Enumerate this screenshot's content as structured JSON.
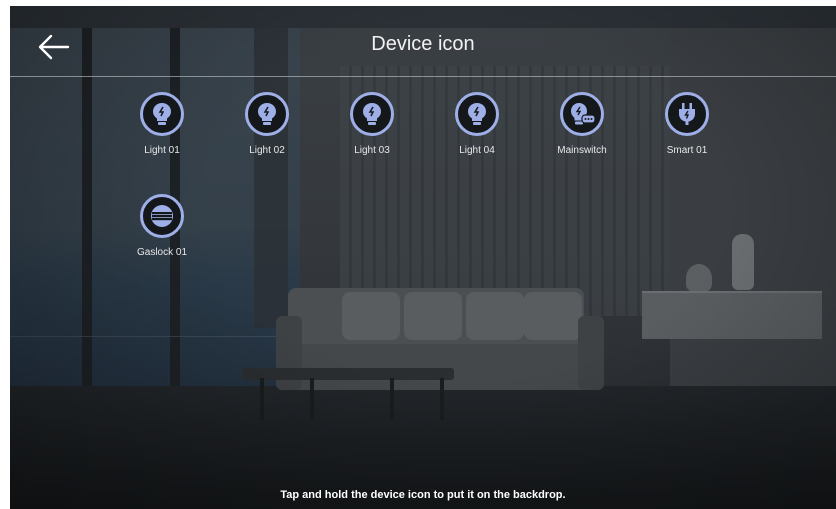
{
  "header": {
    "title": "Device icon",
    "back_icon": "arrow-left-icon"
  },
  "devices": [
    {
      "label": "Light 01",
      "icon": "bulb-icon"
    },
    {
      "label": "Light 02",
      "icon": "bulb-icon"
    },
    {
      "label": "Light 03",
      "icon": "bulb-icon"
    },
    {
      "label": "Light 04",
      "icon": "bulb-icon"
    },
    {
      "label": "Mainswitch",
      "icon": "bulb-switch-icon"
    },
    {
      "label": "Smart 01",
      "icon": "plug-icon"
    },
    {
      "label": "Gaslock 01",
      "icon": "gaslock-icon"
    }
  ],
  "footer": {
    "message": "Tap and hold the device icon to put it on the backdrop."
  },
  "colors": {
    "icon_ring": "#9eaee6",
    "icon_fill": "#15181b",
    "text": "#ffffff"
  }
}
